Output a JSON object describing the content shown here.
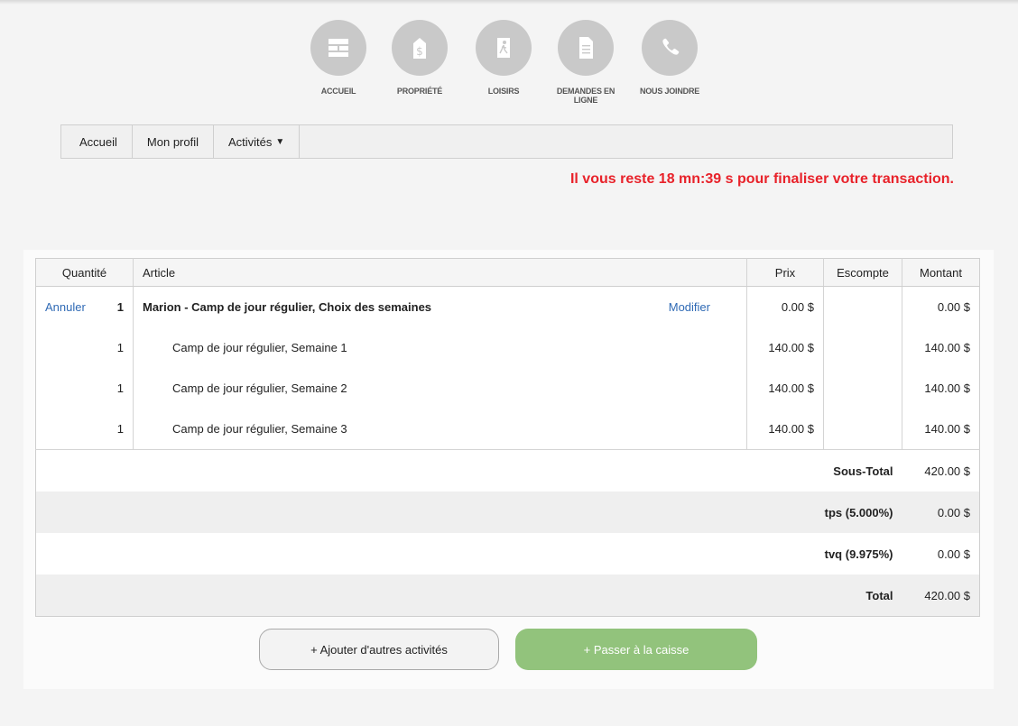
{
  "icon_nav": [
    {
      "label": "ACCUEIL",
      "icon": "home-icon"
    },
    {
      "label": "PROPRIÉTÉ",
      "icon": "property-icon"
    },
    {
      "label": "LOISIRS",
      "icon": "leisure-icon"
    },
    {
      "label": "DEMANDES EN LIGNE",
      "icon": "document-icon"
    },
    {
      "label": "NOUS JOINDRE",
      "icon": "phone-icon"
    }
  ],
  "menu": {
    "home": "Accueil",
    "profile": "Mon profil",
    "activities": "Activités",
    "caret": "▼"
  },
  "timer_text": "Il vous reste 18 mn:39 s pour finaliser votre transaction.",
  "cart": {
    "headers": {
      "quantity": "Quantité",
      "article": "Article",
      "price": "Prix",
      "discount": "Escompte",
      "amount": "Montant"
    },
    "cancel_label": "Annuler",
    "modify_label": "Modifier",
    "main_item": {
      "qty": "1",
      "name": "Marion - Camp de jour régulier, Choix des semaines",
      "price": "0.00 $",
      "discount": "",
      "amount": "0.00 $"
    },
    "sub_items": [
      {
        "qty": "1",
        "name": "Camp de jour régulier, Semaine 1",
        "price": "140.00 $",
        "discount": "",
        "amount": "140.00 $"
      },
      {
        "qty": "1",
        "name": "Camp de jour régulier, Semaine 2",
        "price": "140.00 $",
        "discount": "",
        "amount": "140.00 $"
      },
      {
        "qty": "1",
        "name": "Camp de jour régulier, Semaine 3",
        "price": "140.00 $",
        "discount": "",
        "amount": "140.00 $"
      }
    ],
    "totals": [
      {
        "label": "Sous-Total",
        "value": "420.00 $"
      },
      {
        "label": "tps (5.000%)",
        "value": "0.00 $"
      },
      {
        "label": "tvq (9.975%)",
        "value": "0.00 $"
      },
      {
        "label": "Total",
        "value": "420.00 $"
      }
    ]
  },
  "buttons": {
    "add_more": "+ Ajouter d'autres activités",
    "checkout": "+ Passer à la caisse"
  },
  "colors": {
    "timer": "#e8222a",
    "link": "#2f6ab5",
    "checkout": "#92c37c",
    "icon_circle": "#c9c9c9"
  }
}
